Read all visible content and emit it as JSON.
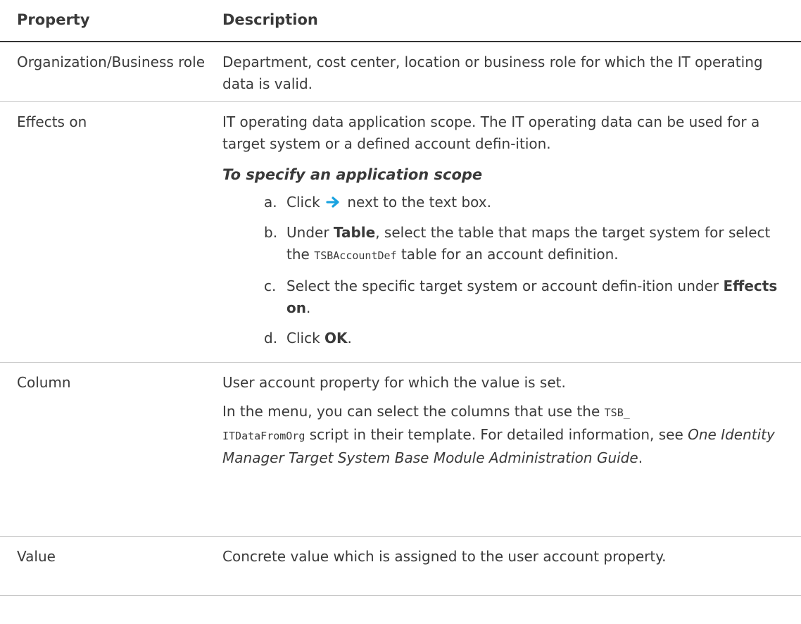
{
  "table": {
    "headers": {
      "property": "Property",
      "description": "Description"
    },
    "rows": [
      {
        "property": "Organization/Business role",
        "description": "Department, cost center, location or business role for which the IT operating data is valid."
      },
      {
        "property": "Effects on",
        "description": "IT operating data application scope. The IT operating data can be used for a target system or a defined account defin-ition.",
        "procedure": {
          "title": "To specify an application scope",
          "steps": [
            {
              "marker": "a.",
              "pre": "Click",
              "post": "next to the text box.",
              "icon": "arrow-right-icon"
            },
            {
              "marker": "b.",
              "pre": "Under",
              "bold": "Table",
              "mid": ", select the table that maps the target system for select the",
              "code": "TSBAccountDef",
              "post": "table for an account definition."
            },
            {
              "marker": "c.",
              "pre": "Select the specific target system or account defin-ition under",
              "bold": "Effects on",
              "post": "."
            },
            {
              "marker": "d.",
              "pre": "Click",
              "bold": "OK",
              "post": "."
            }
          ]
        }
      },
      {
        "property": "Column",
        "description": "User account property for which the value is set.",
        "description2": {
          "pre": "In the menu, you can select the columns that use the",
          "code1": "TSB_",
          "code2": "ITDataFromOrg",
          "mid": "script in their template. For detailed information, see",
          "ref": "One Identity Manager Target System Base Module Administration Guide",
          "post": "."
        }
      },
      {
        "property": "Value",
        "description": "Concrete value which is assigned to the user account property."
      }
    ]
  },
  "colors": {
    "text": "#3a3a3a",
    "arrow": "#1aa3e0",
    "rule": "#c8c8c8"
  }
}
